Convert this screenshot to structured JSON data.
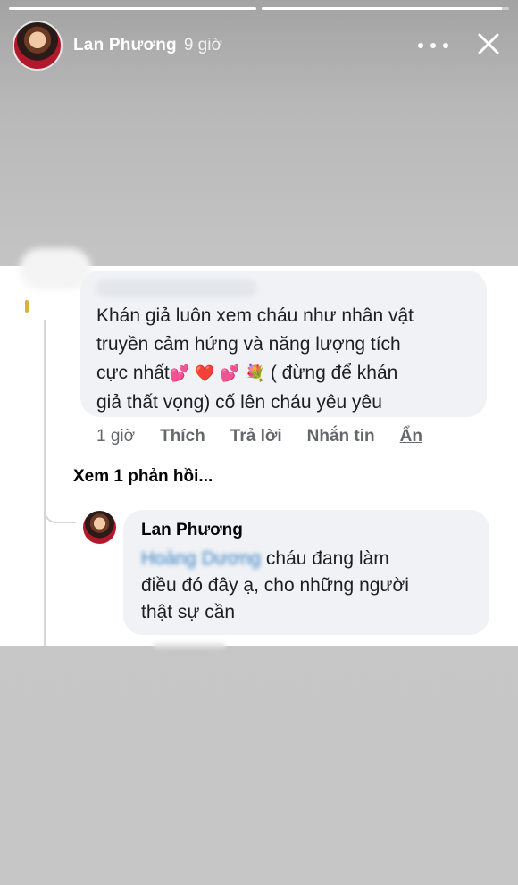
{
  "story": {
    "progress": [
      1.0,
      0.97
    ],
    "author": "Lan Phương",
    "time": "9 giờ",
    "more_icon": "more-horizontal-icon",
    "close_icon": "close-icon"
  },
  "comment": {
    "text_line1": "Khán giả luôn xem cháu như nhân vật",
    "text_line2": "truyền cảm hứng và năng lượng tích",
    "text_line3_start": "cực nhất",
    "text_line3_end": "( đừng để khán",
    "text_line4": "giả thất vọng) cố lên cháu yêu yêu",
    "emojis": [
      "💕",
      "❤️",
      "💕",
      "💐"
    ]
  },
  "actions": {
    "time": "1 giờ",
    "like": "Thích",
    "reply": "Trả lời",
    "message": "Nhắn tin",
    "hide": "Ẩn"
  },
  "view_replies": "Xem 1 phản hồi...",
  "reply": {
    "author": "Lan Phương",
    "mention": "Hoàng Dương",
    "text_line1": "cháu đang làm",
    "text_line2": "điều đó đây ạ, cho những người",
    "text_line3": "thật sự cần"
  },
  "colors": {
    "background": "#c5c5c5",
    "card": "#ffffff",
    "bubble": "#f0f2f5",
    "mention": "#3b82c4",
    "action_text": "#65676b"
  }
}
